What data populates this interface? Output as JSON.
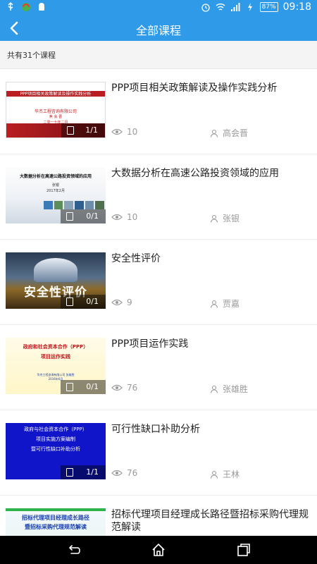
{
  "statusbar": {
    "battery": "87%",
    "time": "09:18"
  },
  "header": {
    "title": "全部课程"
  },
  "count_text": "共有31个课程",
  "items": [
    {
      "title": "PPP项目相关政策解读及操作实践分析",
      "views": "10",
      "author": "高会晋",
      "pages": "1/1",
      "thumb_lines": [
        "PPP项目相关政策解读及操作实践分析",
        "华杰工程咨询有限公司",
        "焦 会 晋",
        "二零一七年二月"
      ]
    },
    {
      "title": "大数据分析在高速公路投资领域的应用",
      "views": "10",
      "author": "张银",
      "pages": "0/1",
      "thumb_lines": [
        "大数据分析在高速公路投资领域的应用",
        "张银",
        "2017年2月"
      ]
    },
    {
      "title": "安全性评价",
      "views": "9",
      "author": "贾嘉",
      "pages": "0/1",
      "thumb_lines": [
        "安全性评价"
      ]
    },
    {
      "title": "PPP项目运作实践",
      "views": "76",
      "author": "张雄胜",
      "pages": "0/1",
      "thumb_lines": [
        "政府和社会资本合作（PPP）",
        "项目运作实践",
        "华杰工程咨询有限公司 张雄胜",
        "2016年6月"
      ]
    },
    {
      "title": "可行性缺口补助分析",
      "views": "76",
      "author": "王林",
      "pages": "1/1",
      "thumb_lines": [
        "政府与社会资本合作（PPP）",
        "项目实施方案编制",
        "暨可行性缺口补助分析"
      ]
    },
    {
      "title": "招标代理项目经理成长路径暨招标采购代理规范解读",
      "views": "",
      "author": "",
      "pages": "",
      "thumb_lines": [
        "招标代理项目经理成长路径",
        "暨招标采购代理规范解读"
      ]
    }
  ]
}
